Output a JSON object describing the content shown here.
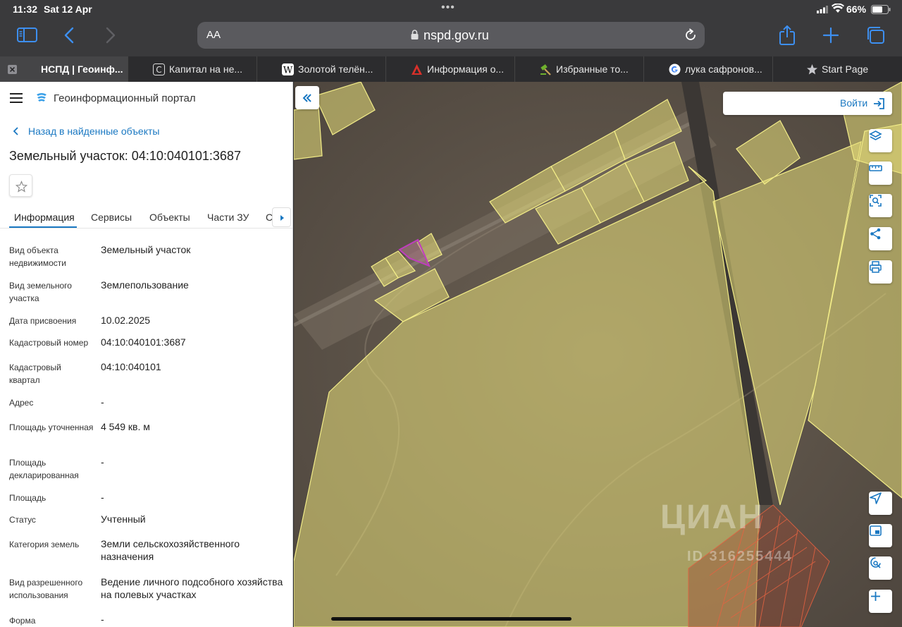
{
  "status_bar": {
    "time": "11:32",
    "date": "Sat 12 Apr",
    "battery": "66%"
  },
  "browser": {
    "address": {
      "aa": "AA",
      "url": "nspd.gov.ru"
    },
    "tabs": [
      {
        "title": "НСПД | Геоинф...",
        "icon": "close-icon",
        "active": true
      },
      {
        "title": "Капитал на не...",
        "icon": "c-favicon-icon"
      },
      {
        "title": "Золотой телён...",
        "icon": "wikipedia-icon"
      },
      {
        "title": "Информация о...",
        "icon": "red-logo-icon"
      },
      {
        "title": "Избранные то...",
        "icon": "hammer-icon"
      },
      {
        "title": "лука сафронов...",
        "icon": "google-icon"
      },
      {
        "title": "Start Page",
        "icon": "star-icon"
      }
    ]
  },
  "sidebar": {
    "portal_name": "Геоинформационный портал",
    "back_link": "Назад в найденные объекты",
    "title": "Земельный участок: 04:10:040101:3687",
    "tabs": [
      "Информация",
      "Сервисы",
      "Объекты",
      "Части ЗУ",
      "Св"
    ],
    "rows": [
      {
        "label": "Вид объекта недвижимости",
        "value": "Земельный участок"
      },
      {
        "label": "Вид земельного участка",
        "value": "Землепользование"
      },
      {
        "label": "Дата присвоения",
        "value": "10.02.2025"
      },
      {
        "label": "Кадастровый номер",
        "value": "04:10:040101:3687"
      },
      {
        "label": "Кадастровый квартал",
        "value": "04:10:040101"
      },
      {
        "label": "Адрес",
        "value": "-"
      },
      {
        "label": "Площадь уточненная",
        "value": "4 549 кв. м"
      },
      {
        "label": "Площадь декларированная",
        "value": "-"
      },
      {
        "label": "Площадь",
        "value": "-"
      },
      {
        "label": "Статус",
        "value": "Учтенный"
      },
      {
        "label": "Категория земель",
        "value": "Земли сельскохозяйственного назначения"
      },
      {
        "label": "Вид разрешенного использования",
        "value": "Ведение личного подсобного хозяйства на полевых участках"
      },
      {
        "label": "Форма",
        "value": "-"
      }
    ]
  },
  "map": {
    "login_label": "Войти",
    "watermark": "ЦИАН",
    "watermark_id": "ID 316255444"
  }
}
